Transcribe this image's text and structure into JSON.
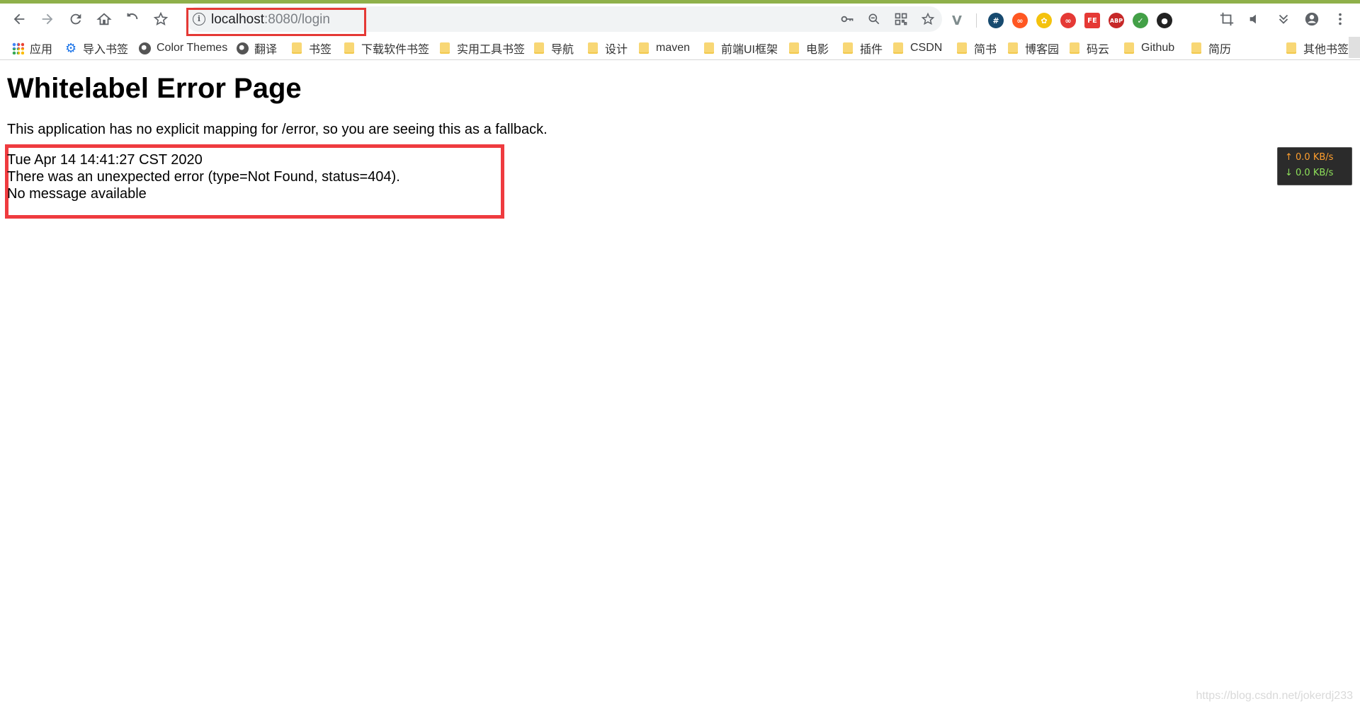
{
  "browser": {
    "accent_color": "#8fb04a",
    "nav": {
      "back_icon": "arrow-left-icon",
      "forward_icon": "arrow-right-icon",
      "reload_icon": "reload-icon",
      "home_icon": "home-icon",
      "undo_icon": "undo-icon",
      "bookmark_icon": "star-icon"
    },
    "omnibox": {
      "host": "localhost",
      "rest": ":8080/login",
      "info_glyph": "i"
    },
    "extensions": [
      {
        "name": "vue-devtools-icon",
        "glyph": "V",
        "color": "#7f8c8d"
      },
      {
        "name": "hash-icon",
        "glyph": "#",
        "color": "#174a6f"
      },
      {
        "name": "infinity-icon",
        "glyph": "∞",
        "color": "#ff5722"
      },
      {
        "name": "chick-icon",
        "glyph": "✿",
        "color": "#f4c20d"
      },
      {
        "name": "infinity-red-icon",
        "glyph": "∞",
        "color": "#e53935"
      },
      {
        "name": "fe-icon",
        "glyph": "FE",
        "color": "#e53935"
      },
      {
        "name": "abp-icon",
        "glyph": "ABP",
        "color": "#c62828"
      },
      {
        "name": "shield-icon",
        "glyph": "✓",
        "color": "#43a047"
      },
      {
        "name": "circle-icon",
        "glyph": "●",
        "color": "#222222"
      }
    ]
  },
  "bookmarks": [
    {
      "label": "应用",
      "icon": "apps-grid-icon"
    },
    {
      "label": "导入书签",
      "icon": "gear-icon"
    },
    {
      "label": "Color Themes",
      "icon": "globe-icon"
    },
    {
      "label": "翻译",
      "icon": "globe-icon"
    },
    {
      "label": "书签",
      "icon": "folder-icon"
    },
    {
      "label": "下载软件书签",
      "icon": "folder-icon"
    },
    {
      "label": "实用工具书签",
      "icon": "folder-icon"
    },
    {
      "label": "导航",
      "icon": "folder-icon"
    },
    {
      "label": "设计",
      "icon": "folder-icon"
    },
    {
      "label": "maven",
      "icon": "folder-icon"
    },
    {
      "label": "前端UI框架",
      "icon": "folder-icon"
    },
    {
      "label": "电影",
      "icon": "folder-icon"
    },
    {
      "label": "插件",
      "icon": "folder-icon"
    },
    {
      "label": "CSDN",
      "icon": "folder-icon"
    },
    {
      "label": "简书",
      "icon": "folder-icon"
    },
    {
      "label": "博客园",
      "icon": "folder-icon"
    },
    {
      "label": "码云",
      "icon": "folder-icon"
    },
    {
      "label": "Github",
      "icon": "folder-icon"
    },
    {
      "label": "简历",
      "icon": "folder-icon"
    }
  ],
  "other_bookmarks": "其他书签",
  "page": {
    "title": "Whitelabel Error Page",
    "description": "This application has no explicit mapping for /error, so you are seeing this as a fallback.",
    "timestamp": "Tue Apr 14 14:41:27 CST 2020",
    "error_line": "There was an unexpected error (type=Not Found, status=404).",
    "message": "No message available",
    "highlight_color": "#ef3b3f"
  },
  "net_monitor": {
    "upload": "↑ 0.0 KB/s",
    "download": "↓ 0.0 KB/s"
  },
  "watermark": "https://blog.csdn.net/jokerdj233"
}
